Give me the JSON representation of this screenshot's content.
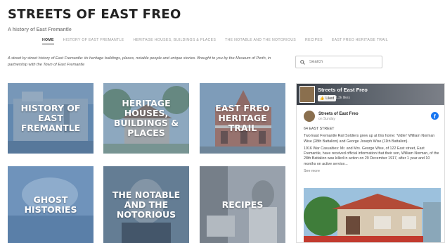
{
  "site": {
    "title": "STREETS OF EAST FREO",
    "tagline": "A history of East Fremantle"
  },
  "nav": [
    {
      "label": "HOME",
      "active": true
    },
    {
      "label": "HISTORY OF EAST FREMANTLE"
    },
    {
      "label": "HERITAGE HOUSES, BUILDINGS & PLACES"
    },
    {
      "label": "THE NOTABLE AND THE NOTORIOUS"
    },
    {
      "label": "RECIPES"
    },
    {
      "label": "EAST FREO HERITAGE TRAIL"
    }
  ],
  "intro": {
    "text": "A street by street history of East Fremantle: its heritage buildings, places, notable people and unique stories. Brought to you by the",
    "link1": "Museum of Perth",
    "middle": ", in partnership with the",
    "link2": "Town of East Fremantle"
  },
  "search": {
    "placeholder": "Search"
  },
  "tiles": [
    {
      "label": "HISTORY OF EAST FREMANTLE"
    },
    {
      "label": "HERITAGE HOUSES, BUILDINGS & PLACES"
    },
    {
      "label": "EAST FREO HERITAGE TRAIL"
    },
    {
      "label": "GHOST HISTORIES"
    },
    {
      "label": "THE NOTABLE AND THE NOTORIOUS"
    },
    {
      "label": "RECIPES"
    }
  ],
  "facebook": {
    "cover_title": "Streets of East Freo",
    "like_label": "Liked",
    "like_count": "1.3k likes",
    "page_name": "Streets of East Freo",
    "post_time": "on Sunday",
    "post_heading": "64 EAST STREET",
    "post_p1": "Two East Fremantle Rail Soldiers grew up at this home: 'Vidler' William Norman Wise (28th Battalion) and George Joseph Wise (11th Battalion).",
    "post_p2": "1916 War Casualties: Mr. and Mrs. George Wise, of 122 East street, East Fremantle, have received official information that their son, William Norman, of the 28th Battalion was killed in action on 29 December 1917, after 1 year and 10 months on active service...",
    "see_more": "See more"
  },
  "colors": {
    "nav_active": "#333333",
    "nav_inactive": "#9a9a9a",
    "facebook_blue": "#1877f2"
  }
}
